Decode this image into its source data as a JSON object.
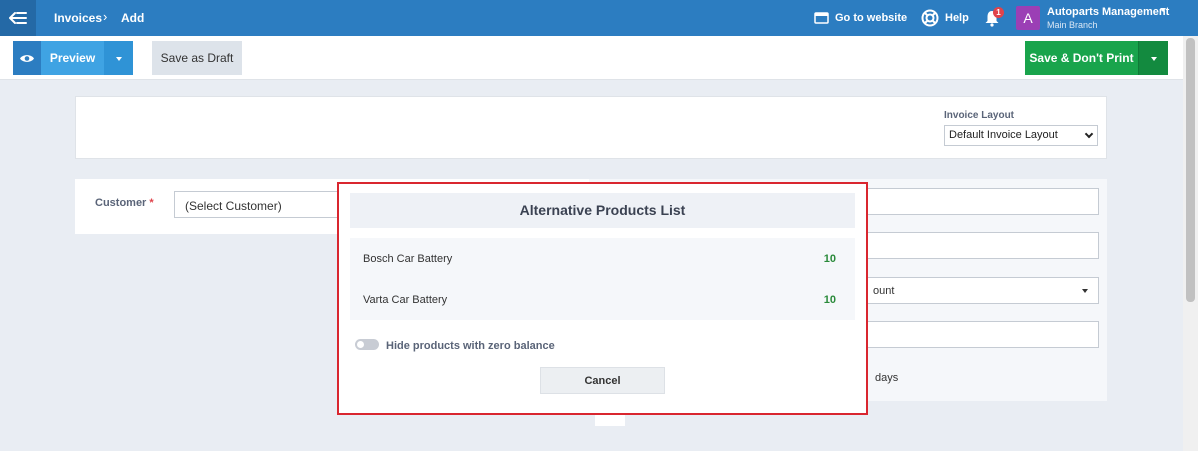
{
  "topbar": {
    "breadcrumb": [
      "Invoices",
      "Add"
    ],
    "go_to_website": "Go to website",
    "help": "Help",
    "notifications_count": "1",
    "account": {
      "initial": "A",
      "name": "Autoparts Management",
      "branch": "Main Branch"
    }
  },
  "toolbar": {
    "preview_label": "Preview",
    "save_draft_label": "Save as Draft",
    "save_label": "Save & Don't Print"
  },
  "invoice_layout": {
    "label": "Invoice Layout",
    "value": "Default Invoice Layout"
  },
  "customer": {
    "label": "Customer",
    "required_mark": "*",
    "value": "(Select Customer)"
  },
  "right_fields": {
    "select_partial": "ount",
    "days_label": "days"
  },
  "modal": {
    "title": "Alternative Products List",
    "products": [
      {
        "name": "Bosch Car Battery",
        "qty": "10"
      },
      {
        "name": "Varta Car Battery",
        "qty": "10"
      }
    ],
    "toggle_label": "Hide products with zero balance",
    "toggle_on": false,
    "cancel_label": "Cancel"
  },
  "colors": {
    "topbar": "#2c7dc1",
    "save": "#19a44c",
    "modal_border": "#d9262f",
    "qty": "#2a8a3a"
  }
}
